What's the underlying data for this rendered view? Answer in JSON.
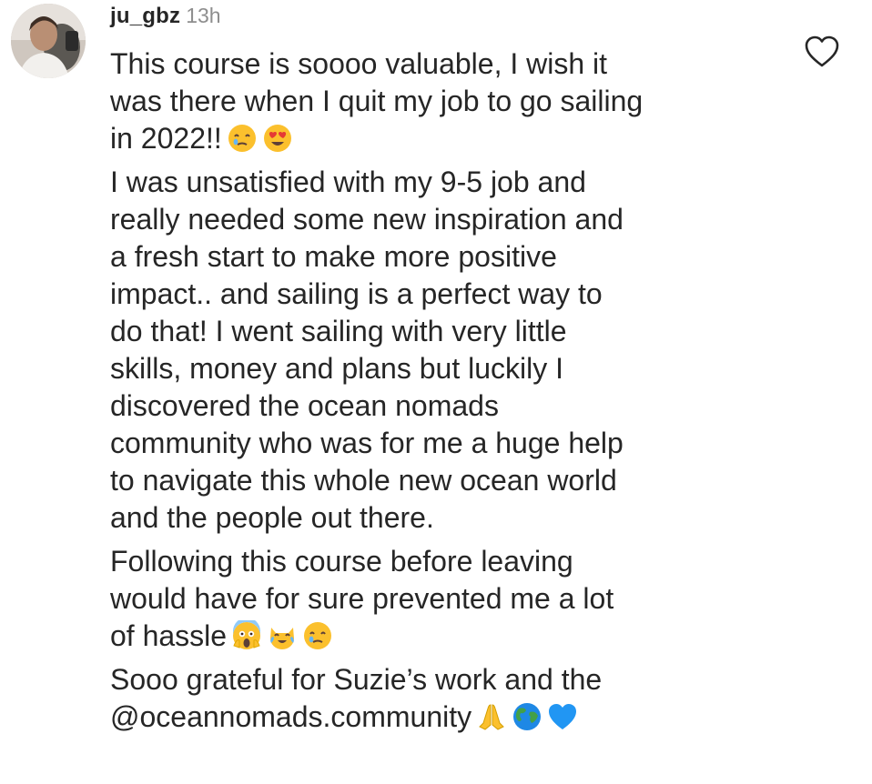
{
  "comment": {
    "username": "ju_gbz",
    "timestamp": "13h",
    "paragraphs": [
      {
        "lines": [
          "This course is soooo valuable, I wish it",
          "was there when I quit my job to go sailing",
          "in 2022!!"
        ],
        "trailing_emojis": [
          "face-holding-back-tears-emoji",
          "heart-eyes-emoji"
        ]
      },
      {
        "lines": [
          "I was unsatisfied with my 9-5 job and",
          "really needed some new inspiration and",
          "a fresh start to make more positive",
          "impact.. and sailing is a perfect way to",
          "do that! I went sailing with very little",
          "skills, money and plans but luckily I",
          "discovered the ocean nomads",
          "community who was for me a huge help",
          "to navigate this whole new ocean world",
          "and the people out there."
        ]
      },
      {
        "lines": [
          "Following this course before leaving",
          "would have for sure prevented me a lot",
          "of hassle"
        ],
        "trailing_emojis": [
          "screaming-face-emoji",
          "cat-tears-of-joy-emoji",
          "face-holding-back-tears-emoji"
        ]
      },
      {
        "lines": [
          "Sooo grateful for Suzie’s work and the",
          "@oceannomads.community"
        ],
        "trailing_emojis": [
          "folded-hands-emoji",
          "globe-emoji",
          "blue-heart-emoji"
        ]
      }
    ],
    "like_icon": "heart-outline-icon"
  },
  "colors": {
    "text": "#262626",
    "timestamp": "#8e8e8e",
    "background": "#ffffff"
  }
}
